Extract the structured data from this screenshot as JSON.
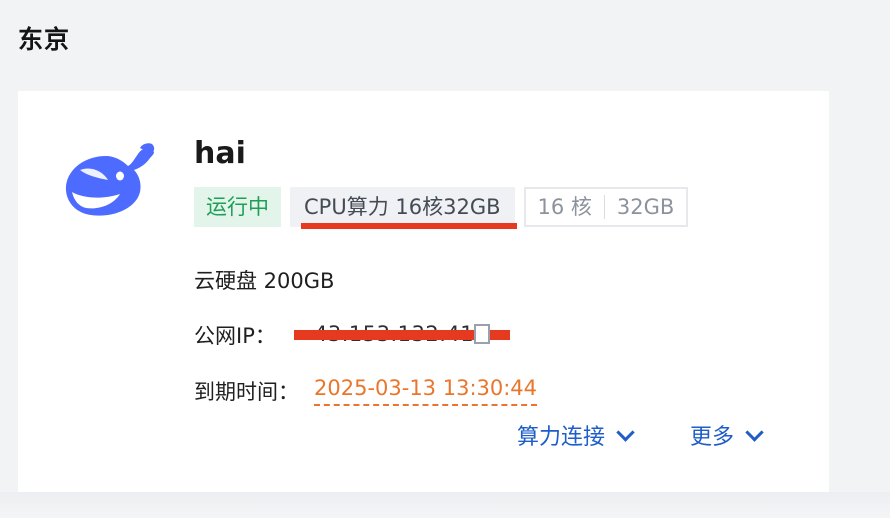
{
  "region": {
    "title": "东京"
  },
  "instance": {
    "name": "hai",
    "status": "运行中",
    "spec": "CPU算力 16核32GB",
    "cores": "16 核",
    "memory": "32GB",
    "disk": "云硬盘 200GB",
    "ip_label": "公网IP：",
    "ip_value": "43.153.132.41",
    "expire_label": "到期时间：",
    "expire_value": "2025-03-13 13:30:44"
  },
  "actions": {
    "connect": "算力连接",
    "more": "更多"
  },
  "colors": {
    "status_green": "#1f9e57",
    "status_bg": "#e3f5ea",
    "expire_orange": "#e9762c",
    "link_blue": "#1f5dc9",
    "redaction_red": "#e53a1f",
    "logo_blue": "#4d6bfe"
  },
  "icons": {
    "logo": "whale-logo-icon",
    "copy": "copy-icon",
    "dropdown": "chevron-down-icon"
  }
}
